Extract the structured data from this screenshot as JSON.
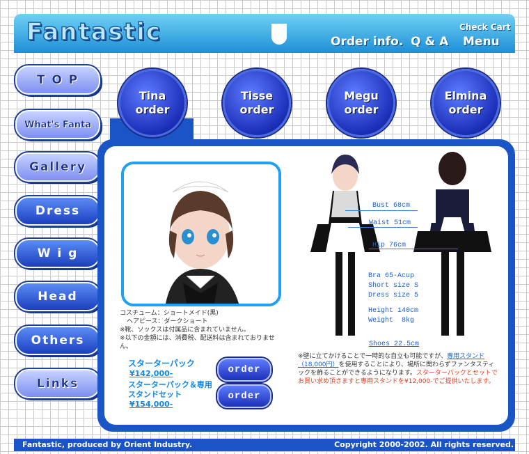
{
  "header": {
    "logo": "Fantastic",
    "order_info": "Order info.",
    "qa": "Q & A",
    "menu": "Menu",
    "check_cart": "Check Cart"
  },
  "left_nav": [
    {
      "label": "T O P",
      "style": "light"
    },
    {
      "label": "What's Fanta",
      "style": "light"
    },
    {
      "label": "Gallery",
      "style": "light"
    },
    {
      "label": "Dress",
      "style": "dark"
    },
    {
      "label": "W i g",
      "style": "dark"
    },
    {
      "label": "Head",
      "style": "dark"
    },
    {
      "label": "Others",
      "style": "dark"
    },
    {
      "label": "Links",
      "style": "light"
    }
  ],
  "orders": [
    {
      "name": "Tina",
      "label": "order"
    },
    {
      "name": "Tisse",
      "label": "order"
    },
    {
      "name": "Megu",
      "label": "order"
    },
    {
      "name": "Elmina",
      "label": "order"
    }
  ],
  "product": {
    "desc1": "コスチューム：ショートメイド(黒)",
    "desc2": "ヘアピース：ダークショート",
    "desc3": "※靴、ソックスは付属品に含まれていません。",
    "desc4": "※以下の金額には、消費税、配送料は含まれておりません。",
    "pack1_name": "スターターパック",
    "pack1_price": "¥142,000-",
    "pack2_name": "スターターパック＆専用スタンドセット",
    "pack2_price": "¥154,000-",
    "order_label": "order"
  },
  "measurements": {
    "bust": "Bust 68cm",
    "waist": "Waist 51cm",
    "hip": "Hip 76cm",
    "bra": "Bra 65-Acup",
    "short": "Short size S",
    "dress": "Dress size 5",
    "height": "Height 140cm",
    "weight": "Weight  8kg",
    "shoes": "Shoes 22.5cm"
  },
  "note": {
    "part1": "※壁に立てかけることで一時的な自立も可能ですが、",
    "link": "専用スタンド（18,000円）",
    "part2": "を使用することにより、場所に関わらずファンタスティックを飾ることができるようになります。",
    "red": "スターターパックとセットでお買い求め頂きますと専用スタンドを¥12,000-でご提供いたします。"
  },
  "footer": {
    "left": "Fantastic, produced by Orient Industry.",
    "right": "Copyright 2000-2002. All rights reserved."
  }
}
